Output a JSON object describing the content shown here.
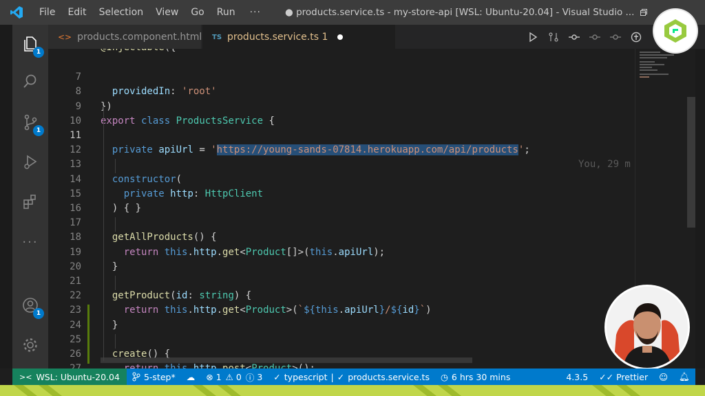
{
  "window": {
    "menu": [
      "File",
      "Edit",
      "Selection",
      "View",
      "Go",
      "Run",
      "···"
    ],
    "title": "● products.service.ts - my-store-api [WSL: Ubuntu-20.04] - Visual Studio ..."
  },
  "activity_bar": {
    "badges": {
      "explorer": "1",
      "source_control": "1",
      "accounts": "1"
    }
  },
  "tabs": [
    {
      "label": "products.component.html",
      "icon": "html-file-icon"
    },
    {
      "label": "products.service.ts 1",
      "icon": "TS"
    }
  ],
  "editor": {
    "line_numbers": [
      "7",
      "8",
      "9",
      "10",
      "11",
      "12",
      "13",
      "14",
      "15",
      "16",
      "17",
      "18",
      "19",
      "20",
      "21",
      "22",
      "23",
      "24",
      "25",
      "26",
      "27"
    ],
    "blame": "You, 29 m"
  },
  "status_bar": {
    "remote": "WSL: Ubuntu-20.04",
    "branch": "5-step*",
    "errors": "1",
    "warnings": "0",
    "info": "3",
    "language": "typescript",
    "file": "products.service.ts",
    "time": "6 hrs 30 mins",
    "version": "4.3.5",
    "formatter": "Prettier"
  },
  "colors": {
    "accent": "#007acc",
    "remote": "#16825d",
    "title_bar": "#3c3c3c",
    "editor_bg": "#1e1e1e",
    "band": "#c0d64a"
  }
}
